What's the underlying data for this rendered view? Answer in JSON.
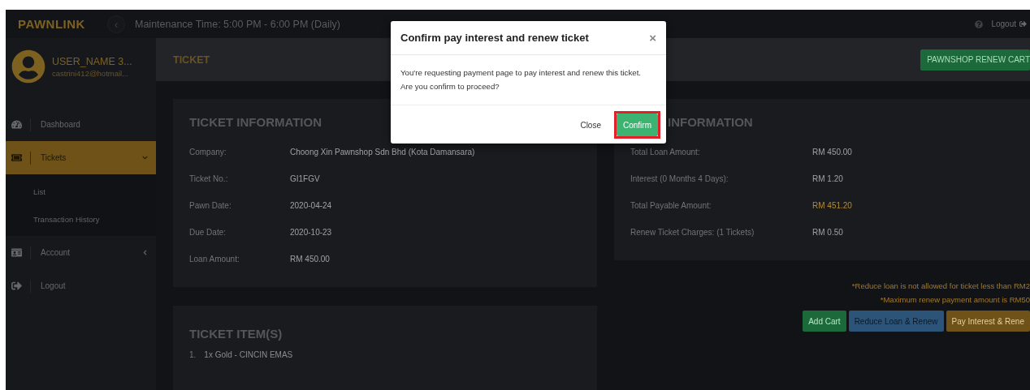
{
  "topbar": {
    "brand": "PAWNLINK",
    "back_icon": "‹",
    "maintenance": "Maintenance Time: 5:00 PM - 6:00 PM (Daily)",
    "logout": "Logout"
  },
  "user": {
    "name": "USER_NAME 3...",
    "email": "castrini412@hotmail..."
  },
  "sidebar": {
    "items": [
      {
        "label": "Dashboard",
        "kind": "link",
        "selected": false
      },
      {
        "label": "Tickets",
        "kind": "group",
        "selected": true,
        "expanded": true,
        "children": [
          {
            "label": "List",
            "selected": false
          },
          {
            "label": "Transaction History",
            "selected": false
          }
        ]
      },
      {
        "label": "Account",
        "kind": "group",
        "selected": false,
        "expanded": false
      },
      {
        "label": "Logout",
        "kind": "link",
        "selected": false
      }
    ]
  },
  "page_header": {
    "title": "TICKET",
    "cart_button": "PAWNSHOP RENEW CART"
  },
  "ticket_info": {
    "title": "TICKET INFORMATION",
    "rows": [
      {
        "label": "Company:",
        "value": "Choong Xin Pawnshop Sdn Bhd (Kota Damansara)"
      },
      {
        "label": "Ticket No.:",
        "value": "GI1FGV"
      },
      {
        "label": "Pawn Date:",
        "value": "2020-04-24"
      },
      {
        "label": "Due Date:",
        "value": "2020-10-23"
      },
      {
        "label": "Loan Amount:",
        "value": "RM 450.00"
      }
    ]
  },
  "payment_info": {
    "title": "INFORMATION",
    "rows": [
      {
        "label": "Total Loan Amount:",
        "value": "RM 450.00",
        "highlight": false
      },
      {
        "label": "Interest (0 Months 4 Days):",
        "value": "RM 1.20",
        "highlight": false
      },
      {
        "label": "Total Payable Amount:",
        "value": "RM 451.20",
        "highlight": true
      },
      {
        "label": "Renew Ticket Charges: (1 Tickets)",
        "value": "RM 0.50",
        "highlight": false
      }
    ]
  },
  "notes": [
    "*Reduce loan is not allowed for ticket less than RM2",
    "*Maximum renew payment amount is RM50"
  ],
  "actions": [
    {
      "label": "Add Cart",
      "kind": "add"
    },
    {
      "label": "Reduce Loan & Renew",
      "kind": "reduce"
    },
    {
      "label": "Pay Interest & Rene",
      "kind": "pay"
    }
  ],
  "ticket_items": {
    "title": "TICKET ITEM(S)",
    "items": [
      {
        "number": "1.",
        "text": "1x Gold - CINCIN EMAS"
      }
    ]
  },
  "modal": {
    "title": "Confirm pay interest and renew ticket",
    "close": "×",
    "message_lines": [
      "You're requesting payment page to pay interest and renew this ticket.",
      "Are you confirm to proceed?"
    ],
    "buttons": [
      {
        "label": "Close",
        "kind": "plain",
        "highlighted": false
      },
      {
        "label": "Confirm",
        "kind": "primary",
        "highlighted": true
      }
    ]
  }
}
